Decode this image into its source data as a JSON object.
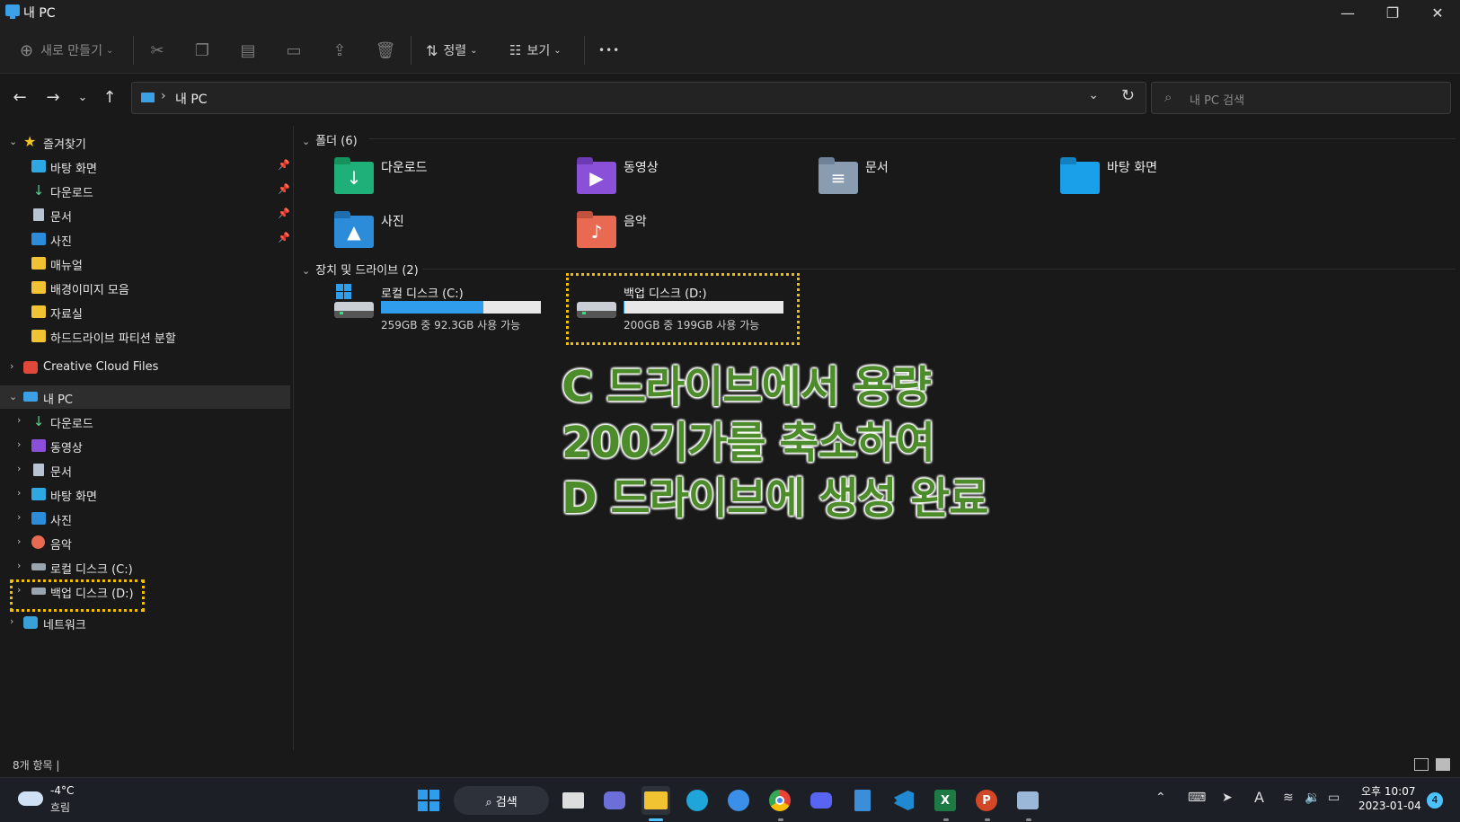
{
  "window": {
    "title": "내 PC",
    "min": "—",
    "max": "❐",
    "close": "✕"
  },
  "toolbar": {
    "new_label": "새로 만들기",
    "sort_label": "정렬",
    "view_label": "보기",
    "more": "•••"
  },
  "nav": {
    "address": "내 PC",
    "search_placeholder": "내 PC 검색"
  },
  "sidebar": {
    "favorites_label": "즐겨찾기",
    "favorites": [
      {
        "label": "바탕 화면",
        "icon": "desktop-icon",
        "pinned": true
      },
      {
        "label": "다운로드",
        "icon": "download-icon",
        "pinned": true
      },
      {
        "label": "문서",
        "icon": "document-icon",
        "pinned": true
      },
      {
        "label": "사진",
        "icon": "pictures-icon",
        "pinned": true
      },
      {
        "label": "매뉴얼",
        "icon": "folder-icon",
        "pinned": false
      },
      {
        "label": "배경이미지 모음",
        "icon": "folder-icon",
        "pinned": false
      },
      {
        "label": "자료실",
        "icon": "folder-icon",
        "pinned": false
      },
      {
        "label": "하드드라이브 파티션 분할",
        "icon": "folder-icon",
        "pinned": false
      }
    ],
    "creative_cloud": "Creative Cloud Files",
    "this_pc": "내 PC",
    "pc_items": [
      {
        "label": "다운로드",
        "icon": "download-icon"
      },
      {
        "label": "동영상",
        "icon": "videos-icon"
      },
      {
        "label": "문서",
        "icon": "document-icon"
      },
      {
        "label": "바탕 화면",
        "icon": "desktop-icon"
      },
      {
        "label": "사진",
        "icon": "pictures-icon"
      },
      {
        "label": "음악",
        "icon": "music-icon"
      },
      {
        "label": "로컬 디스크 (C:)",
        "icon": "drive-icon"
      },
      {
        "label": "백업 디스크 (D:)",
        "icon": "drive-icon"
      }
    ],
    "network": "네트워크"
  },
  "content": {
    "folders_header": "폴더 (6)",
    "folders": [
      {
        "label": "다운로드",
        "color": "#1fb07a",
        "glyph": "↓"
      },
      {
        "label": "동영상",
        "color": "#8b50d8",
        "glyph": "▶"
      },
      {
        "label": "문서",
        "color": "#8a9cb0",
        "glyph": "≡"
      },
      {
        "label": "바탕 화면",
        "color": "#1aa0e8",
        "glyph": ""
      },
      {
        "label": "사진",
        "color": "#2c8cd9",
        "glyph": "▲"
      },
      {
        "label": "음악",
        "color": "#e96a52",
        "glyph": "♪"
      }
    ],
    "drives_header": "장치 및 드라이브 (2)",
    "drives": [
      {
        "name": "로컬 디스크 (C:)",
        "free": "259GB 중 92.3GB 사용 가능",
        "used_fraction": 0.64
      },
      {
        "name": "백업 디스크 (D:)",
        "free": "200GB 중 199GB 사용 가능",
        "used_fraction": 0.005
      }
    ]
  },
  "overlay": {
    "line1": "C 드라이브에서 용량",
    "line2": "200기가를 축소하여",
    "line3": "D 드라이브에 생성 완료"
  },
  "status": {
    "item_count": "8개 항목 |"
  },
  "taskbar": {
    "temp": "-4°C",
    "weather": "흐림",
    "search": "⌕ 검색",
    "time": "오후 10:07",
    "date": "2023-01-04",
    "notifications": "4"
  }
}
